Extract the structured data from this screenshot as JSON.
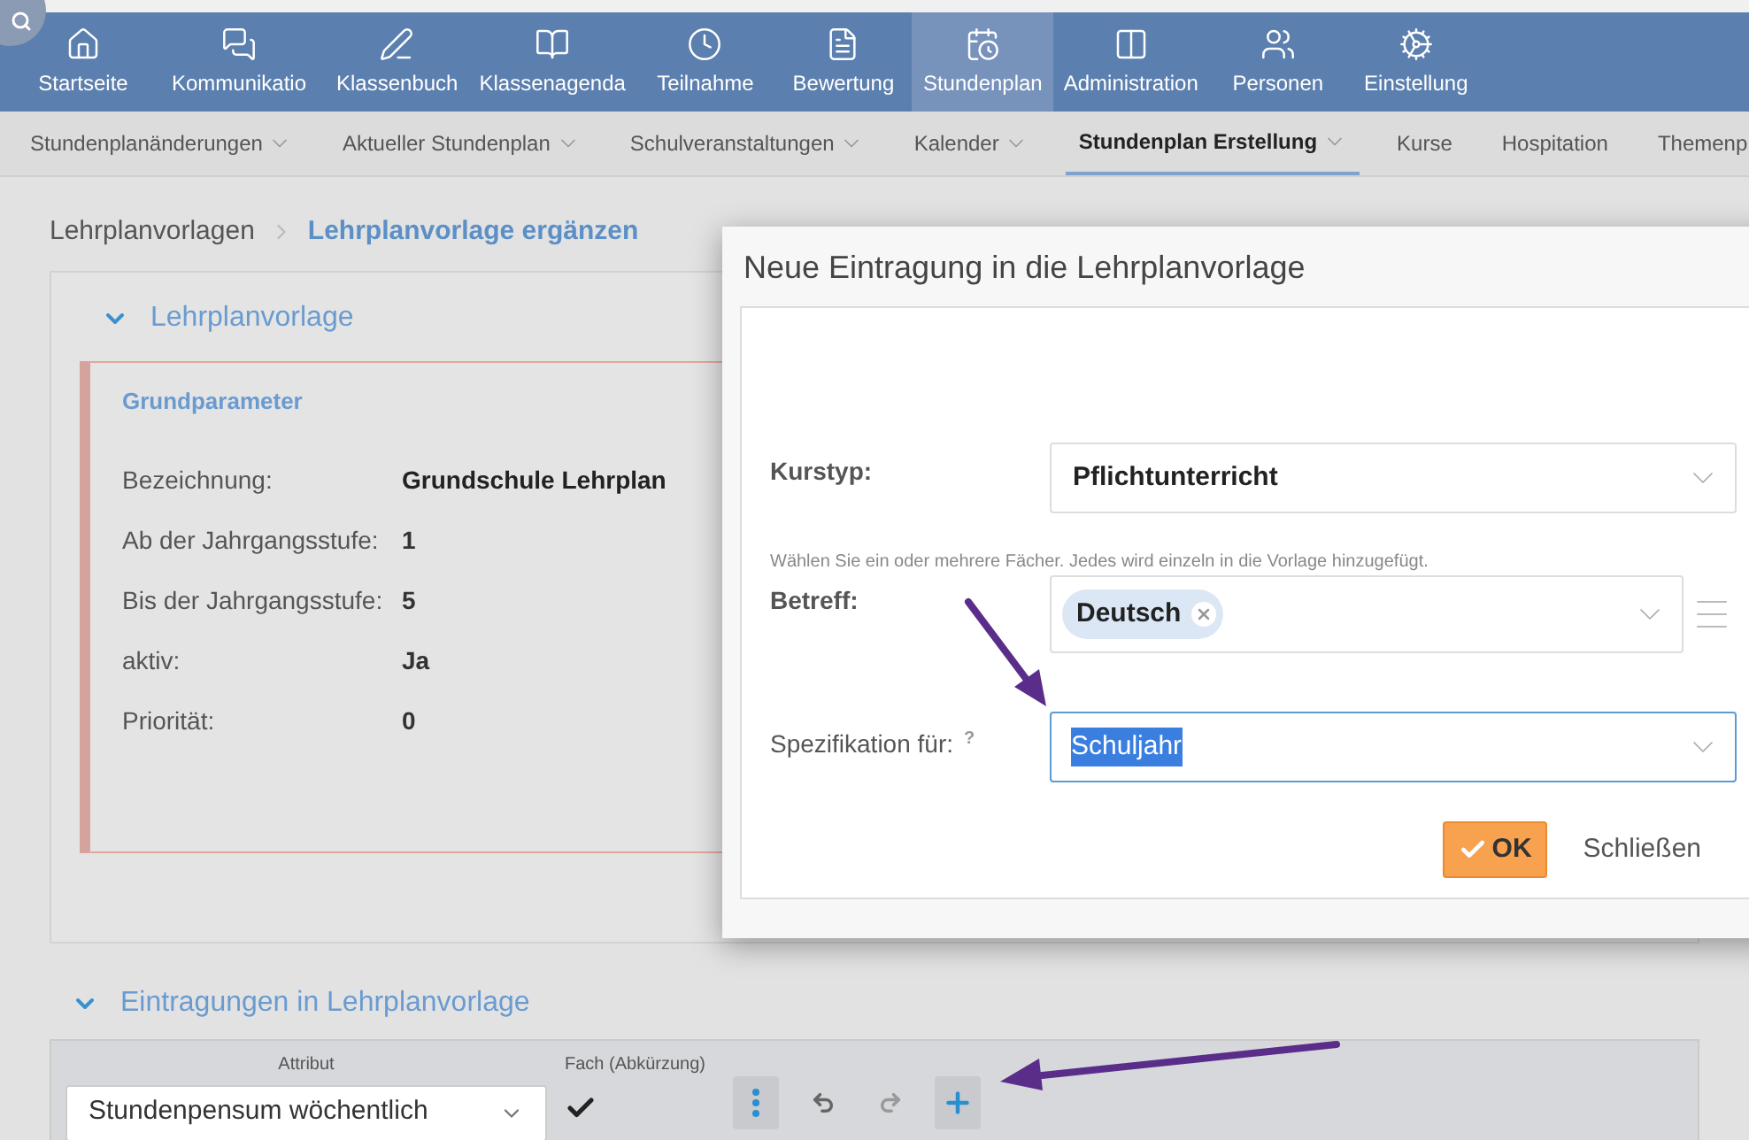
{
  "nav": {
    "items": [
      {
        "label": "Startseite",
        "selected": false
      },
      {
        "label": "Kommunikatio",
        "selected": false
      },
      {
        "label": "Klassenbuch",
        "selected": false
      },
      {
        "label": "Klassenagenda",
        "selected": false
      },
      {
        "label": "Teilnahme",
        "selected": false
      },
      {
        "label": "Bewertung",
        "selected": false
      },
      {
        "label": "Stundenplan",
        "selected": true
      },
      {
        "label": "Administration",
        "selected": false
      },
      {
        "label": "Personen",
        "selected": false
      },
      {
        "label": "Einstellung",
        "selected": false
      }
    ]
  },
  "subnav": {
    "items": [
      {
        "label": "Stundenplanänderungen",
        "dropdown": true,
        "selected": false
      },
      {
        "label": "Aktueller Stundenplan",
        "dropdown": true,
        "selected": false
      },
      {
        "label": "Schulveranstaltungen",
        "dropdown": true,
        "selected": false
      },
      {
        "label": "Kalender",
        "dropdown": true,
        "selected": false
      },
      {
        "label": "Stundenplan Erstellung",
        "dropdown": true,
        "selected": true
      },
      {
        "label": "Kurse",
        "dropdown": false,
        "selected": false
      },
      {
        "label": "Hospitation",
        "dropdown": false,
        "selected": false
      },
      {
        "label": "Themenp",
        "dropdown": false,
        "selected": false
      }
    ]
  },
  "breadcrumb": [
    "Lehrplanvorlagen",
    "Lehrplanvorlage ergänzen"
  ],
  "template_section": {
    "title": "Lehrplanvorlage",
    "expanded": true,
    "card_title": "Grundparameter",
    "fields": [
      {
        "label": "Bezeichnung:",
        "value": "Grundschule Lehrplan"
      },
      {
        "label": "Ab der Jahrgangsstufe:",
        "value": "1"
      },
      {
        "label": "Bis der Jahrgangsstufe:",
        "value": "5"
      },
      {
        "label": "aktiv:",
        "value": "Ja"
      },
      {
        "label": "Priorität:",
        "value": "0"
      }
    ]
  },
  "entries_section": {
    "title": "Eintragungen in Lehrplanvorlage",
    "expanded": true,
    "attribute_label": "Attribut",
    "attribute_value": "Stundenpensum wöchentlich",
    "subject_label": "Fach (Abkürzung)",
    "subject_checked": true
  },
  "dialog": {
    "title": "Neue Eintragung in die Lehrplanvorlage",
    "course_type": {
      "label": "Kurstyp:",
      "value": "Pflichtunterricht"
    },
    "hint": "Wählen Sie ein oder mehrere Fächer. Jedes wird einzeln in die Vorlage hinzugefügt.",
    "subject": {
      "label": "Betreff:",
      "chips": [
        "Deutsch"
      ]
    },
    "specification": {
      "label": "Spezifikation für:",
      "help": "?",
      "value": "Schuljahr",
      "focused": true
    },
    "ok": "OK",
    "close": "Schließen"
  }
}
